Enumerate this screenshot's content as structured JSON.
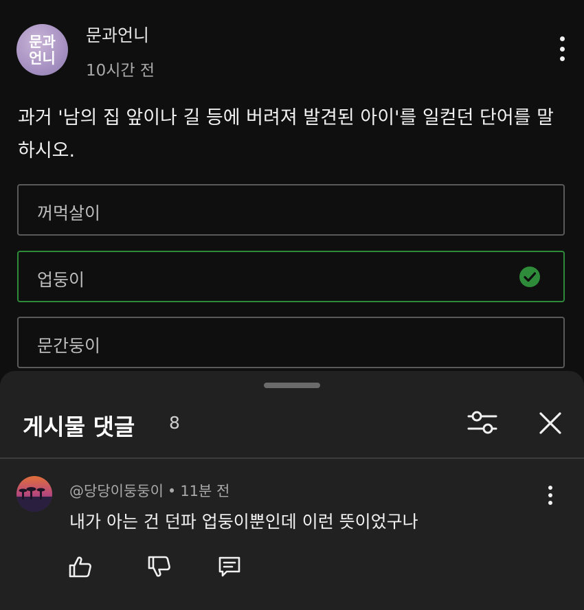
{
  "post": {
    "avatar_text": "문과언니",
    "channel_name": "문과언니",
    "time": "10시간 전",
    "question": "과거 '남의 집 앞이나 길 등에 버려져 발견된 아이'를 일컫던 단어를 말하시오.",
    "options": [
      {
        "label": "꺼먹살이",
        "correct": false
      },
      {
        "label": "업둥이",
        "correct": true
      },
      {
        "label": "문간둥이",
        "correct": false
      }
    ]
  },
  "comments_sheet": {
    "title": "게시물 댓글",
    "count": "8",
    "comments": [
      {
        "author": "@당당이둥둥이",
        "separator": "•",
        "time": "11분 전",
        "text": "내가 아는 건 던파 업둥이뿐인데 이런 뜻이었구나"
      }
    ]
  },
  "colors": {
    "background": "#0f0f0f",
    "sheet": "#212121",
    "correct_accent": "#2e8b3a",
    "secondary_text": "#aaaaaa"
  },
  "icons": [
    "more-vert-icon",
    "check-circle-icon",
    "filter-icon",
    "close-icon",
    "like-icon",
    "dislike-icon",
    "reply-icon"
  ]
}
